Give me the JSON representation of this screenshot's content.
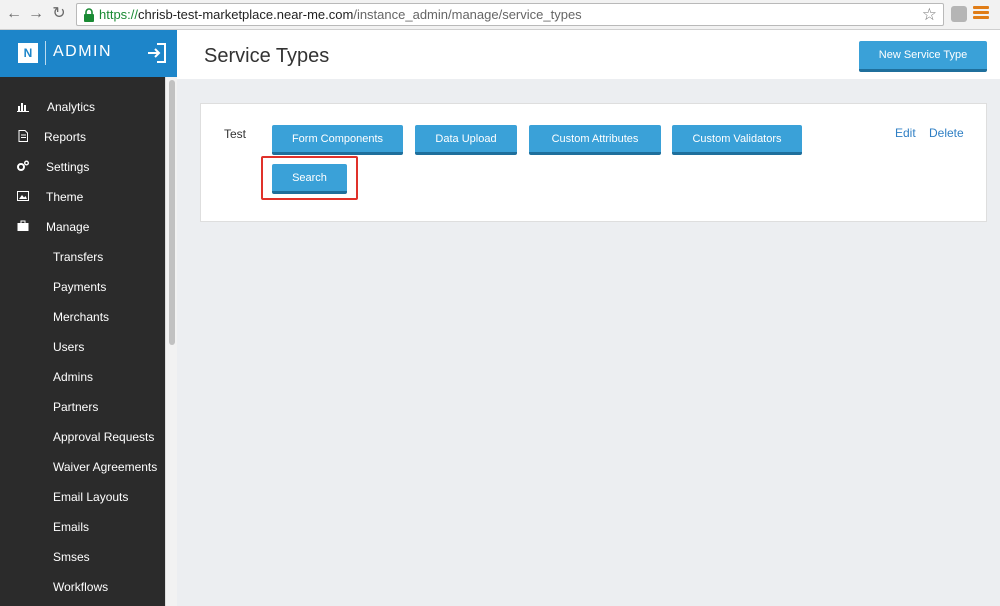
{
  "browser": {
    "url_scheme": "https://",
    "url_host": "chrisb-test-marketplace.near-me.com",
    "url_path": "/instance_admin/manage/service_types",
    "icons": [
      "back-icon",
      "forward-icon",
      "reload-icon",
      "lock-icon",
      "star-icon",
      "extension-icon",
      "menu-icon"
    ]
  },
  "brand": {
    "logo_letter": "N",
    "admin_label": "ADMIN"
  },
  "sidebar": {
    "items": [
      {
        "label": "Analytics",
        "icon": "bar-chart-icon"
      },
      {
        "label": "Reports",
        "icon": "document-icon"
      },
      {
        "label": "Settings",
        "icon": "cogs-icon"
      },
      {
        "label": "Theme",
        "icon": "picture-icon"
      },
      {
        "label": "Manage",
        "icon": "briefcase-icon"
      }
    ],
    "sub_items": [
      {
        "label": "Transfers"
      },
      {
        "label": "Payments"
      },
      {
        "label": "Merchants"
      },
      {
        "label": "Users"
      },
      {
        "label": "Admins"
      },
      {
        "label": "Partners"
      },
      {
        "label": "Approval Requests"
      },
      {
        "label": "Waiver Agreements"
      },
      {
        "label": "Email Layouts"
      },
      {
        "label": "Emails"
      },
      {
        "label": "Smses"
      },
      {
        "label": "Workflows"
      }
    ]
  },
  "header": {
    "title": "Service Types",
    "new_button": "New Service Type"
  },
  "service_type": {
    "name": "Test",
    "buttons": {
      "form_components": "Form Components",
      "data_upload": "Data Upload",
      "custom_attributes": "Custom Attributes",
      "custom_validators": "Custom Validators",
      "search": "Search"
    },
    "edit": "Edit",
    "delete": "Delete"
  },
  "colors": {
    "accent": "#1d85c9",
    "button": "#3aa1d8",
    "sidebar_bg": "#2b2b2b",
    "highlight": "#e0312a",
    "link": "#2f7fc4"
  }
}
